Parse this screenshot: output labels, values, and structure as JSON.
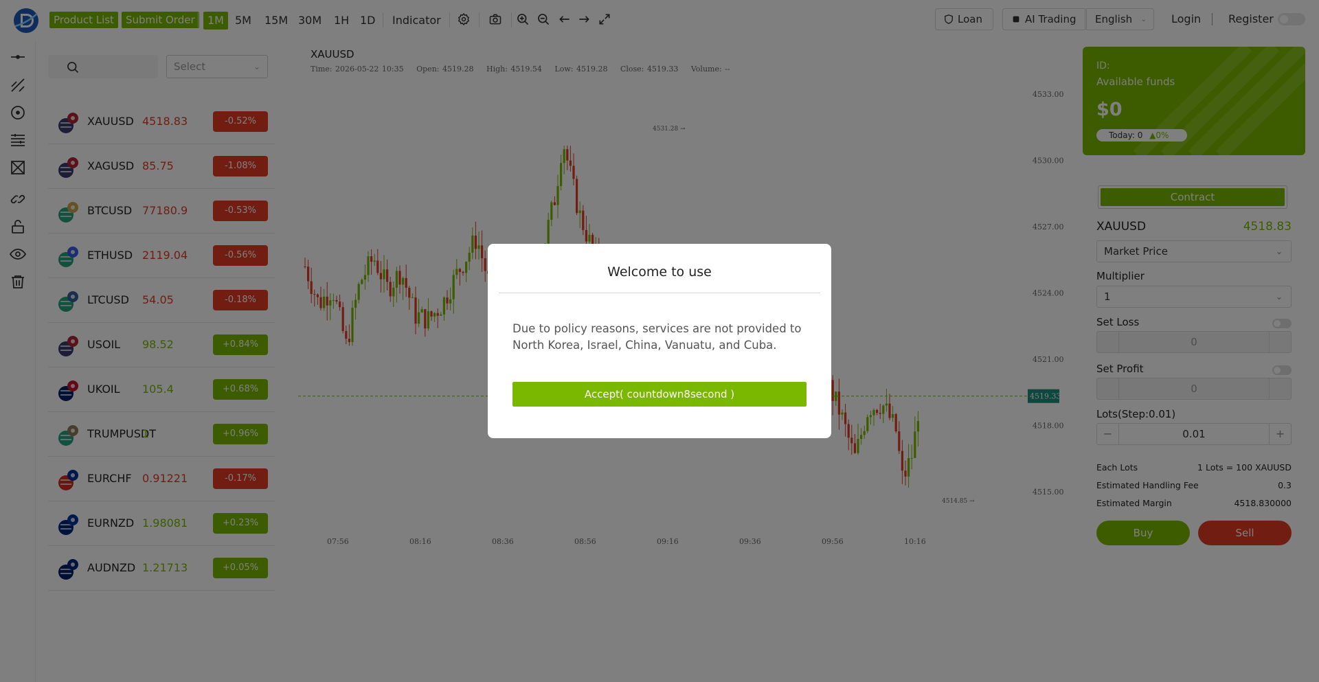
{
  "header": {
    "product_list": "Product List",
    "submit_order": "Submit Order",
    "timeframes": [
      "1M",
      "5M",
      "15M",
      "30M",
      "1H",
      "1D"
    ],
    "active_timeframe": "1M",
    "indicator": "Indicator",
    "loan": "Loan",
    "ai_trading": "AI Trading",
    "language": "English",
    "login": "Login",
    "register": "Register"
  },
  "product_list": {
    "search_placeholder": "",
    "select_placeholder": "Select",
    "items": [
      {
        "symbol": "XAUUSD",
        "price": "4518.83",
        "change": "-0.52%",
        "dir": "down",
        "icon": "us-flag-icon"
      },
      {
        "symbol": "XAGUSD",
        "price": "85.75",
        "change": "-1.08%",
        "dir": "down",
        "icon": "silver-us-flag-icon"
      },
      {
        "symbol": "BTCUSD",
        "price": "77180.9",
        "change": "-0.53%",
        "dir": "down",
        "icon": "bitcoin-tether-icon"
      },
      {
        "symbol": "ETHUSD",
        "price": "2119.04",
        "change": "-0.56%",
        "dir": "down",
        "icon": "ethereum-tether-icon"
      },
      {
        "symbol": "LTCUSD",
        "price": "54.05",
        "change": "-0.18%",
        "dir": "down",
        "icon": "litecoin-tether-icon"
      },
      {
        "symbol": "USOIL",
        "price": "98.52",
        "change": "+0.84%",
        "dir": "up",
        "icon": "oil-us-flag-icon"
      },
      {
        "symbol": "UKOIL",
        "price": "105.4",
        "change": "+0.68%",
        "dir": "up",
        "icon": "oil-uk-flag-icon"
      },
      {
        "symbol": "TRUMPUSDT",
        "price": "1",
        "change": "+0.96%",
        "dir": "up",
        "icon": "trump-tether-icon"
      },
      {
        "symbol": "EURCHF",
        "price": "0.91221",
        "change": "-0.17%",
        "dir": "down",
        "icon": "eu-swiss-flag-icon"
      },
      {
        "symbol": "EURNZD",
        "price": "1.98081",
        "change": "+0.23%",
        "dir": "up",
        "icon": "eu-nz-flag-icon"
      },
      {
        "symbol": "AUDNZD",
        "price": "1.21713",
        "change": "+0.05%",
        "dir": "up",
        "icon": "au-nz-flag-icon"
      }
    ]
  },
  "chart": {
    "symbol": "XAUUSD",
    "info": {
      "time": "Time: 2026-05-22 10:35",
      "open": "Open: 4519.28",
      "high": "High: 4519.54",
      "low": "Low: 4519.28",
      "close": "Close: 4519.33",
      "volume": "Volume: --"
    },
    "y_ticks": [
      "4533.00",
      "4530.00",
      "4527.00",
      "4524.00",
      "4521.00",
      "4518.00",
      "4515.00"
    ],
    "x_ticks": [
      "07:56",
      "08:16",
      "08:36",
      "08:56",
      "09:16",
      "09:36",
      "09:56",
      "10:16"
    ],
    "current_price": "4519.33",
    "high_marker": "4531.28",
    "low_marker": "4514.85",
    "colors": {
      "up": "#7ab800",
      "down": "#e23b25"
    }
  },
  "account": {
    "id_label": "ID:",
    "funds_label": "Available funds",
    "funds": "$0",
    "today": "Today: 0",
    "today_pct": "0%"
  },
  "trade": {
    "contract": "Contract",
    "symbol": "XAUUSD",
    "price": "4518.83",
    "order_type": "Market Price",
    "multiplier_label": "Multiplier",
    "multiplier": "1",
    "set_loss_label": "Set Loss",
    "set_loss": "0",
    "set_profit_label": "Set Profit",
    "set_profit": "0",
    "lots_label": "Lots(Step:0.01)",
    "lots": "0.01",
    "each_lots_label": "Each Lots",
    "each_lots": "1 Lots = 100 XAUUSD",
    "fee_label": "Estimated Handling Fee",
    "fee": "0.3",
    "margin_label": "Estimated Margin",
    "margin": "4518.830000",
    "buy": "Buy",
    "sell": "Sell"
  },
  "modal": {
    "title": "Welcome to use",
    "body": "Due to policy reasons, services are not provided to North Korea, Israel, China, Vanuatu, and Cuba.",
    "button": "Accept( countdown8second )"
  }
}
